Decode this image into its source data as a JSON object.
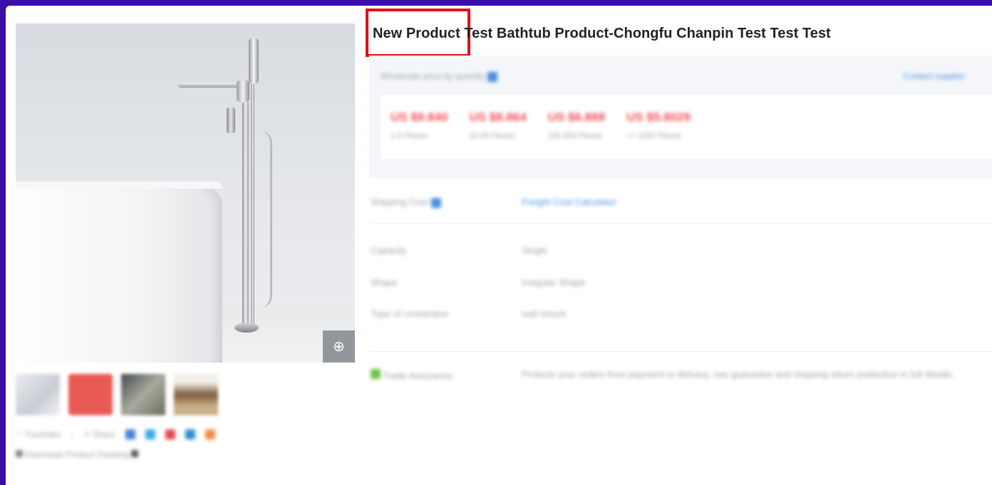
{
  "product": {
    "title": "New Product Test Bathtub Product-Chongfu Chanpin Test Test Test"
  },
  "gallery": {
    "zoom_icon": "zoom-in-icon",
    "thumbnails": [
      "thumbnail-1",
      "thumbnail-2",
      "thumbnail-3",
      "thumbnail-4"
    ]
  },
  "actions": {
    "favorite_label": "♡ Favorites",
    "share_label": "↗ Share",
    "download_label": "Download Product Drawing"
  },
  "price_panel": {
    "header_left": "Wholesale price by quantity",
    "header_right": "Contact supplier",
    "tiers": [
      {
        "price": "US $9.840",
        "qty": "1-9 Pieces"
      },
      {
        "price": "US $8.864",
        "qty": "10-99 Pieces"
      },
      {
        "price": "US $6.888",
        "qty": "100-999 Pieces"
      },
      {
        "price": "US $5.8029",
        "qty": ">= 1000 Pieces"
      }
    ]
  },
  "shipping": {
    "label": "Shipping Cost",
    "value": "Freight Cost Calculator"
  },
  "attributes": [
    {
      "key": "Capacity",
      "value": "Single"
    },
    {
      "key": "Shape",
      "value": "Irregular Shape"
    },
    {
      "key": "Type of connection",
      "value": "wall mount"
    }
  ],
  "trade_assurance": {
    "label": "Trade Assurance",
    "value": "Protects your orders from payment to delivery, see guarantee and shipping return protection in full details."
  },
  "colors": {
    "accent_red": "#ef4c53",
    "highlight_box": "#e40f18",
    "border_purple": "#3a0fa8",
    "link_blue": "#4a90e2"
  }
}
